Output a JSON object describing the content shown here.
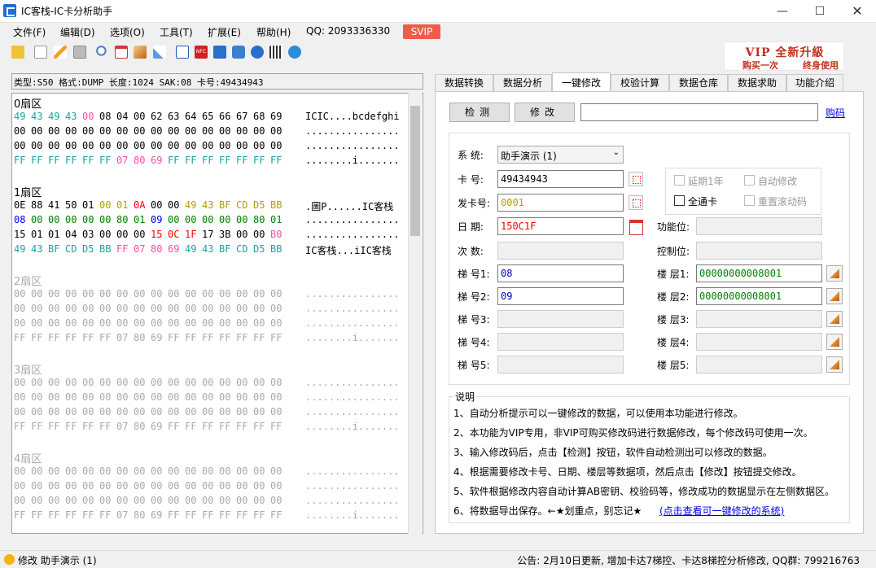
{
  "window": {
    "title": "IC客栈-IC卡分析助手"
  },
  "menu": [
    "文件(F)",
    "编辑(D)",
    "选项(O)",
    "工具(T)",
    "扩展(E)",
    "帮助(H)"
  ],
  "qq": "QQ:  2093336330",
  "svip": "SVIP",
  "vip_banner": {
    "title": "VIP 全新升級",
    "left": "购买一次",
    "right": "终身使用"
  },
  "toolbar_icons": [
    "folder-icon",
    "new-file-icon",
    "edit-icon",
    "save-icon",
    "search-icon",
    "calendar-icon",
    "stairs-icon",
    "brush-icon",
    "export-icon",
    "nfc-icon",
    "copy-icon",
    "find-icon",
    "help-icon",
    "qrcode-icon",
    "settings-icon"
  ],
  "info_bar": "类型:S50 格式:DUMP 长度:1024 SAK:08 卡号:49434943",
  "sectors": [
    {
      "title": "0扇区",
      "active": true,
      "rows": [
        {
          "hex": [
            "49",
            "43",
            "49",
            "43",
            "00",
            "08",
            "04",
            "00",
            "62",
            "63",
            "64",
            "65",
            "66",
            "67",
            "68",
            "69"
          ],
          "colors": [
            "teal",
            "teal",
            "teal",
            "teal",
            "pnk",
            "",
            "",
            "",
            "",
            "",
            "",
            "",
            "",
            "",
            "",
            ""
          ],
          "ascii": "ICIC....bcdefghi"
        },
        {
          "hex": [
            "00",
            "00",
            "00",
            "00",
            "00",
            "00",
            "00",
            "00",
            "00",
            "00",
            "00",
            "00",
            "00",
            "00",
            "00",
            "00"
          ],
          "colors": [],
          "ascii": "................"
        },
        {
          "hex": [
            "00",
            "00",
            "00",
            "00",
            "00",
            "00",
            "00",
            "00",
            "00",
            "00",
            "00",
            "00",
            "00",
            "00",
            "00",
            "00"
          ],
          "colors": [],
          "ascii": "................"
        },
        {
          "hex": [
            "FF",
            "FF",
            "FF",
            "FF",
            "FF",
            "FF",
            "07",
            "80",
            "69",
            "FF",
            "FF",
            "FF",
            "FF",
            "FF",
            "FF",
            "FF"
          ],
          "colors": [
            "teal",
            "teal",
            "teal",
            "teal",
            "teal",
            "teal",
            "pnk",
            "pnk",
            "pnk",
            "teal",
            "teal",
            "teal",
            "teal",
            "teal",
            "teal",
            "teal"
          ],
          "ascii": "........i......."
        }
      ]
    },
    {
      "title": "1扇区",
      "active": true,
      "rows": [
        {
          "hex": [
            "0E",
            "88",
            "41",
            "50",
            "01",
            "00",
            "01",
            "0A",
            "00",
            "00",
            "49",
            "43",
            "BF",
            "CD",
            "D5",
            "BB"
          ],
          "colors": [
            "",
            "",
            "",
            "",
            "",
            "olv",
            "olv",
            "red",
            "",
            "",
            "olv",
            "olv",
            "olv",
            "olv",
            "olv",
            "olv"
          ],
          "ascii": ".圖P......IC客栈"
        },
        {
          "hex": [
            "08",
            "00",
            "00",
            "00",
            "00",
            "00",
            "80",
            "01",
            "09",
            "00",
            "00",
            "00",
            "00",
            "00",
            "80",
            "01"
          ],
          "colors": [
            "blu",
            "grn",
            "grn",
            "grn",
            "grn",
            "grn",
            "grn",
            "grn",
            "blu",
            "grn",
            "grn",
            "grn",
            "grn",
            "grn",
            "grn",
            "grn"
          ],
          "ascii": "................"
        },
        {
          "hex": [
            "15",
            "01",
            "01",
            "04",
            "03",
            "00",
            "00",
            "00",
            "15",
            "0C",
            "1F",
            "17",
            "3B",
            "00",
            "00",
            "B0"
          ],
          "colors": [
            "",
            "",
            "",
            "",
            "",
            "",
            "",
            "",
            "red",
            "red",
            "red",
            "",
            "",
            "",
            "",
            "pnk"
          ],
          "ascii": "................"
        },
        {
          "hex": [
            "49",
            "43",
            "BF",
            "CD",
            "D5",
            "BB",
            "FF",
            "07",
            "80",
            "69",
            "49",
            "43",
            "BF",
            "CD",
            "D5",
            "BB"
          ],
          "colors": [
            "teal",
            "teal",
            "teal",
            "teal",
            "teal",
            "teal",
            "pnk",
            "pnk",
            "pnk",
            "pnk",
            "teal",
            "teal",
            "teal",
            "teal",
            "teal",
            "teal"
          ],
          "ascii": "IC客栈...iIC客栈"
        }
      ]
    },
    {
      "title": "2扇区",
      "active": false
    },
    {
      "title": "3扇区",
      "active": false
    },
    {
      "title": "4扇区",
      "active": false
    }
  ],
  "empty_rows": [
    {
      "hex": [
        "00",
        "00",
        "00",
        "00",
        "00",
        "00",
        "00",
        "00",
        "00",
        "00",
        "00",
        "00",
        "00",
        "00",
        "00",
        "00"
      ],
      "ascii": "................"
    },
    {
      "hex": [
        "00",
        "00",
        "00",
        "00",
        "00",
        "00",
        "00",
        "00",
        "00",
        "00",
        "00",
        "00",
        "00",
        "00",
        "00",
        "00"
      ],
      "ascii": "................"
    },
    {
      "hex": [
        "00",
        "00",
        "00",
        "00",
        "00",
        "00",
        "00",
        "00",
        "00",
        "00",
        "00",
        "00",
        "00",
        "00",
        "00",
        "00"
      ],
      "ascii": "................"
    },
    {
      "hex": [
        "FF",
        "FF",
        "FF",
        "FF",
        "FF",
        "FF",
        "07",
        "80",
        "69",
        "FF",
        "FF",
        "FF",
        "FF",
        "FF",
        "FF",
        "FF"
      ],
      "ascii": "........i......."
    }
  ],
  "tabs": [
    "数据转换",
    "数据分析",
    "一键修改",
    "校验计算",
    "数据仓库",
    "数据求助",
    "功能介绍"
  ],
  "active_tab": 2,
  "modify": {
    "detect_btn": "检测",
    "modify_btn": "修改",
    "code_input": "",
    "buy_link": "购码",
    "system_label": "系  统:",
    "system_value": "助手演示 (1)",
    "card_label": "卡  号:",
    "card_value": "49434943",
    "issue_label": "发卡号:",
    "issue_value": "0001",
    "date_label": "日  期:",
    "date_value": "150C1F",
    "count_label": "次  数:",
    "elevators": [
      {
        "label": "梯 号1:",
        "value": "08"
      },
      {
        "label": "梯 号2:",
        "value": "09"
      },
      {
        "label": "梯 号3:",
        "value": ""
      },
      {
        "label": "梯 号4:",
        "value": ""
      },
      {
        "label": "梯 号5:",
        "value": ""
      }
    ],
    "floors": [
      {
        "label": "楼 层1:",
        "value": "00000000008001"
      },
      {
        "label": "楼 层2:",
        "value": "00000000008001"
      },
      {
        "label": "楼 层3:",
        "value": ""
      },
      {
        "label": "楼 层4:",
        "value": ""
      },
      {
        "label": "楼 层5:",
        "value": ""
      }
    ],
    "func_label": "功能位:",
    "ctrl_label": "控制位:",
    "checkboxes": [
      {
        "label": "延期1年",
        "checked": false,
        "enabled": false
      },
      {
        "label": "自动修改",
        "checked": false,
        "enabled": false
      },
      {
        "label": "全通卡",
        "checked": false,
        "enabled": true
      },
      {
        "label": "重置滚动码",
        "checked": false,
        "enabled": false
      }
    ]
  },
  "notes": {
    "title": "说明",
    "lines": [
      "1、自动分析提示可以一键修改的数据，可以使用本功能进行修改。",
      "2、本功能为VIP专用，非VIP可购买修改码进行数据修改，每个修改码可使用一次。",
      "3、输入修改码后，点击【检测】按钮，软件自动检测出可以修改的数据。",
      "4、根据需要修改卡号、日期、楼层等数据项，然后点击【修改】按钮提交修改。",
      "5、软件根据修改内容自动计算AB密钥、校验码等，修改成功的数据显示在左侧数据区。",
      "6、将数据导出保存。←★划重点，别忘记★"
    ],
    "link": "(点击查看可一键修改的系统)"
  },
  "status": {
    "left": "修改 助手演示 (1)",
    "right": "公告: 2月10日更新, 增加卡达7梯控、卡达8梯控分析修改, QQ群: 799216763"
  }
}
